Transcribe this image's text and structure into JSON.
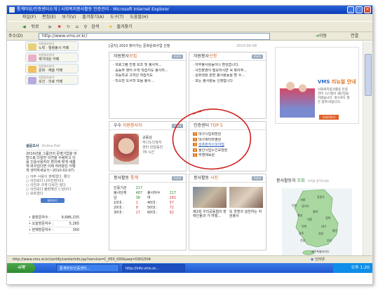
{
  "window": {
    "title": "통계마당/인증센터소개 | 사회복지봉사활동 인증관리 - Microsoft Internet Explorer",
    "min_glyph": "_",
    "max_glyph": "□",
    "close_glyph": "×"
  },
  "menu": [
    "파일(F)",
    "편집(E)",
    "보기(V)",
    "즐겨찾기(A)",
    "도구(T)",
    "도움말(H)"
  ],
  "toolbar": {
    "back": "뒤로",
    "search": "검색",
    "favorites": "즐겨찾기"
  },
  "address": {
    "label": "주소(D)",
    "url": "http://www.vms.or.kr/",
    "go": "이동",
    "links": "연결"
  },
  "left": {
    "categories": [
      {
        "sub": "지원봉사분야",
        "name": "노력 · 행정봉사 카페",
        "color": "#e8d07a"
      },
      {
        "sub": "지원봉사분야",
        "name": "재가대상 카페",
        "color": "#e8b0c8"
      },
      {
        "sub": "지원봉사분야",
        "name": "문화 · 예술 카페",
        "color": "#f0c060"
      },
      {
        "sub": "지원봉사분야",
        "name": "보건 · 의료 카페",
        "color": "#b8a8e0"
      }
    ],
    "poll": {
      "title": "설문조사",
      "subtitle": "Online Poll",
      "question": "2010년을 그룹안의 문영기업을 비방으로 다양한 의견을 수렴하고 이를 인증사용자의 편의에 맞게 새롭게 바꾸었다면 이제 여러분은 어떻게 생각하세요?(~2010-02-07)",
      "options": [
        "아주 사용이 편해졌다. 좋다",
        "이전보다 나아진편이다",
        "이전과 크게 다르진 않다",
        "이전보다 불편해진 느낌이다",
        "모르겠다"
      ],
      "button": "결과보기"
    },
    "stats": [
      {
        "label": "총방문자수 :",
        "value": "9,686,235"
      },
      {
        "label": "오늘방문자수 :",
        "value": "5,265"
      },
      {
        "label": "현재방문자수 :",
        "value": "300"
      }
    ]
  },
  "main": {
    "notice": {
      "text": "[공지] 2010 찾아가는 문화순회사업 선정",
      "date": "2010-04-08"
    },
    "recruit": {
      "title_a": "자원봉사",
      "title_b": "모집",
      "more": "more",
      "items": [
        "프로그램 진행 보조 및 봉사자...",
        "중동부 영어·수학 학습지도 봉사자...",
        "초등학교 고학년 학습지도",
        "미소반 도서학 모음 봉사..."
      ]
    },
    "apply": {
      "title_a": "자원봉사",
      "title_b": "신청",
      "more": "more",
      "items": [
        "아무봉사활동이나 편성습니다.",
        "사진촬영이 필요하시면 꼭 찾아주...",
        "문화생활 관련 봉사활동을 할 수...",
        "모든 봉사활동 신청합니다"
      ]
    },
    "volunteer": {
      "title_a": "우수",
      "title_b": "자원봉사자",
      "more": "more",
      "name": "교동남",
      "desc": "하나노인복지센터 한달동안 78 시간"
    },
    "top5": {
      "title_a": "인증센터",
      "title_b": "TOP 5",
      "items": [
        "대구시립희망원",
        "대구파티마병원",
        "성프란치스꼬의집",
        "울산시립노인요양원",
        "부영애육원"
      ]
    },
    "activity_stats": {
      "title_a": "봉사활동",
      "title_b": "통계",
      "more": "more",
      "rows": [
        {
          "a": "인증기관",
          "b": "217"
        },
        {
          "a": "봉사단체",
          "b": "487",
          "c": "봉사자수",
          "d": "217"
        },
        {
          "a": "남",
          "b": "36",
          "c": "여",
          "d": "181"
        },
        {
          "a": "10대 :",
          "b": "1",
          "c": "40대 :",
          "d": "57"
        },
        {
          "a": "20대 :",
          "b": "9",
          "c": "50대 :",
          "d": "71"
        },
        {
          "a": "30대 :",
          "b": "17",
          "c": "60대 :",
          "d": "62"
        }
      ]
    },
    "photos": {
      "title_a": "봉사활동",
      "title_b": "사진",
      "more": "more",
      "items": [
        "제2회 우리공동협의 장애인들과 가 여행...",
        "또 한명의 실천하는 자원봉사"
      ]
    }
  },
  "right": {
    "banner": {
      "title_a": "VMS",
      "title_b": "리뉴얼 안내",
      "text": "사회복지봉사활동 인증관리 시스템이 새단장을 하였습니다. 앞으로도 많은 참여 바랍니다.",
      "button": "자세히보기"
    },
    "map": {
      "title_a": "봉사활동처",
      "title_b": "조회",
      "hint": "지역을 클릭하세요",
      "regions": [
        "강원도",
        "서울",
        "인천",
        "경기도",
        "충북",
        "충남",
        "대전",
        "경북",
        "전북",
        "대구",
        "울산",
        "경남",
        "광주",
        "부산",
        "전남",
        "제주특별자치도"
      ]
    }
  },
  "statusbar": {
    "url": "http://www.vms.or.kr/certify/centerInfo.jsp?service=C_050_000&seq=0301504",
    "zone": "인터넷"
  },
  "taskbar": {
    "start": "시작",
    "tasks": [
      "통계마당/인증센터...",
      "http://info.vms.or..."
    ],
    "time": "오후 1:20"
  }
}
